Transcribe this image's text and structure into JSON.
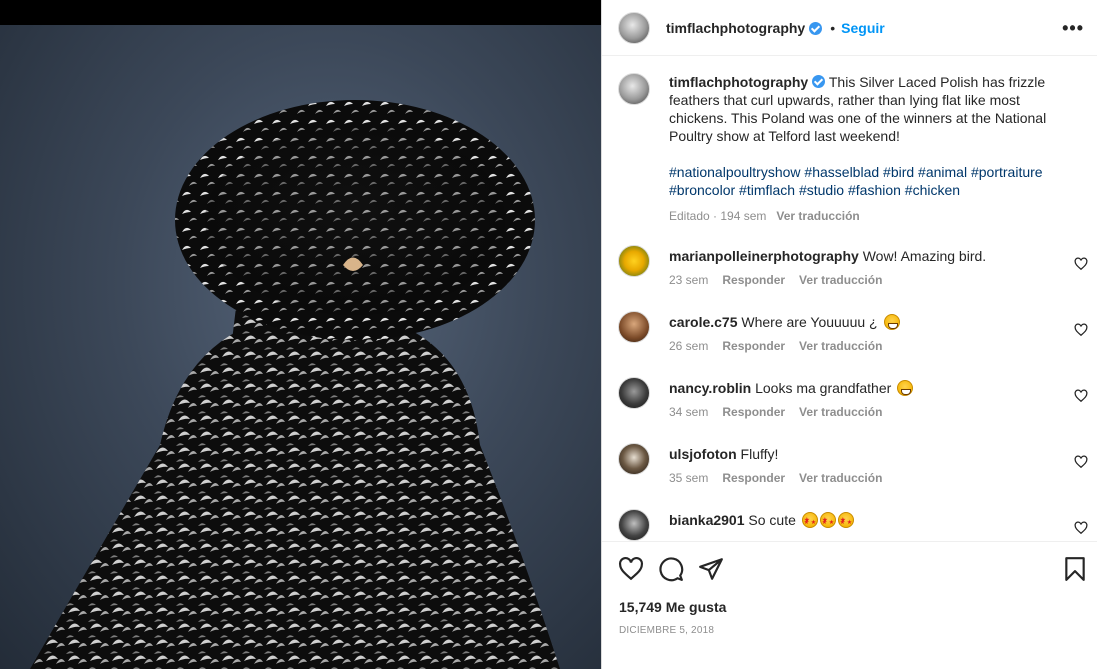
{
  "post": {
    "username": "timflachphotography",
    "follow_label": "Seguir",
    "separator": "•",
    "more_label": "•••",
    "caption_text": "This Silver Laced Polish has frizzle feathers that curl upwards, rather than lying flat like most chickens. This Poland was one of the winners at the National Poultry show at Telford last weekend!",
    "hashtags_line1": "#nationalpoultryshow #hasselblad #bird #animal #portraiture",
    "hashtags_line2": "#broncolor #timflach #studio #fashion #chicken",
    "caption_edited": "Editado · 194 sem",
    "translate_label": "Ver traducción",
    "likes": "15,749 Me gusta",
    "date": "DICIEMBRE 5, 2018"
  },
  "comments": [
    {
      "username": "marianpolleinerphotography",
      "text": "Wow! Amazing bird.",
      "time": "23 sem",
      "reply": "Responder",
      "translate": "Ver traducción",
      "emoji": ""
    },
    {
      "username": "carole.c75",
      "text": "Where are Youuuuu ¿",
      "time": "26 sem",
      "reply": "Responder",
      "translate": "Ver traducción",
      "emoji": "grinning-face"
    },
    {
      "username": "nancy.roblin",
      "text": "Looks ma grandfather",
      "time": "34 sem",
      "reply": "Responder",
      "translate": "Ver traducción",
      "emoji": "grinning-face"
    },
    {
      "username": "ulsjofoton",
      "text": "Fluffy!",
      "time": "35 sem",
      "reply": "Responder",
      "translate": "Ver traducción",
      "emoji": ""
    },
    {
      "username": "bianka2901",
      "text": "So cute",
      "time": "",
      "reply": "",
      "translate": "",
      "emoji": "star-struck x3"
    }
  ],
  "colors": {
    "follow": "#0095f6",
    "hashtag": "#00376b",
    "verified": "#3897f0",
    "meta": "#8e8e8e"
  }
}
